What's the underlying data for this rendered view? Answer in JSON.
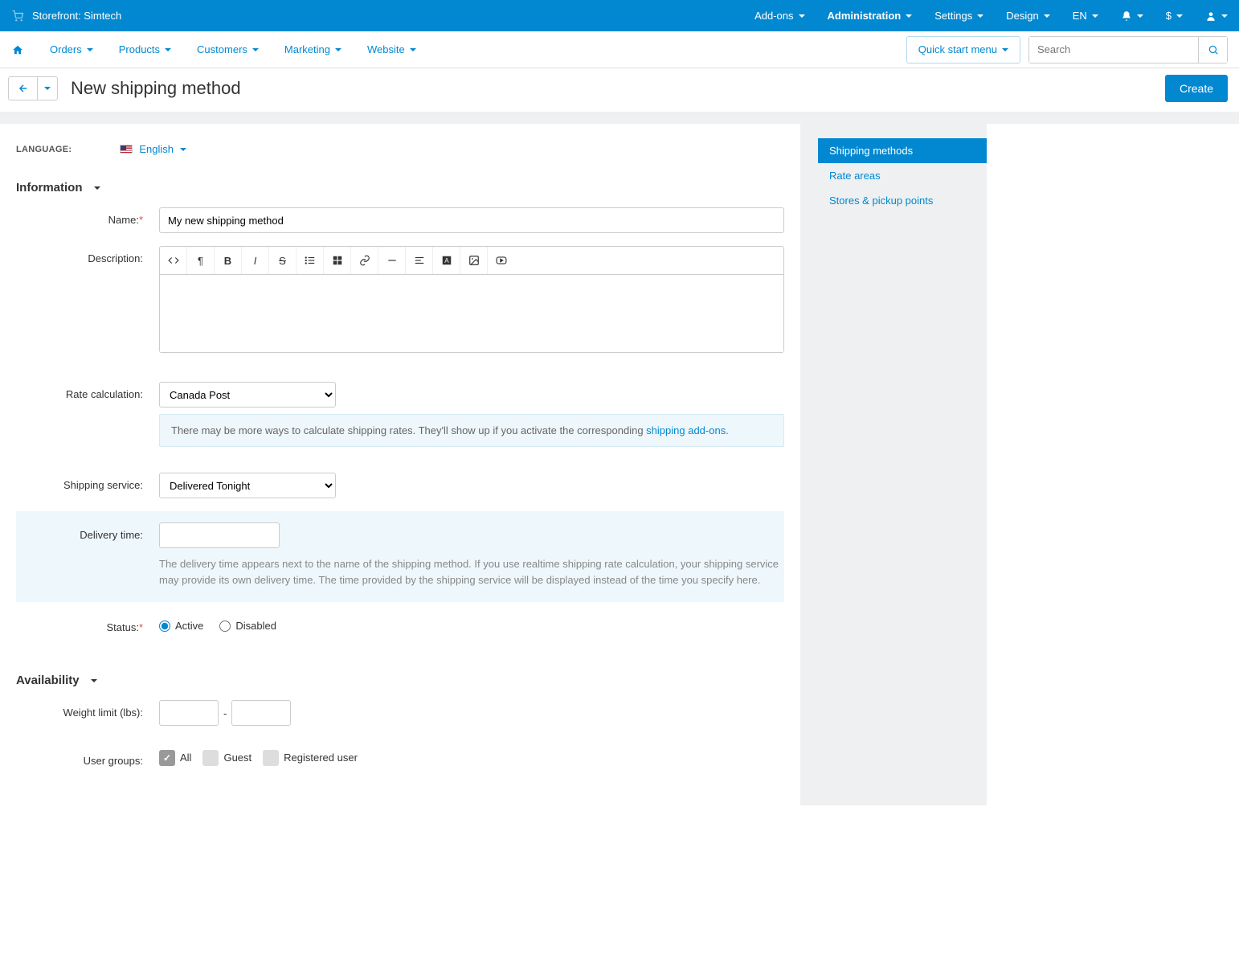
{
  "topbar": {
    "storefront_label": "Storefront: Simtech",
    "addons": "Add-ons",
    "administration": "Administration",
    "settings": "Settings",
    "design": "Design",
    "lang": "EN",
    "currency": "$"
  },
  "nav": {
    "orders": "Orders",
    "products": "Products",
    "customers": "Customers",
    "marketing": "Marketing",
    "website": "Website",
    "quick_start": "Quick start menu",
    "search_placeholder": "Search"
  },
  "page": {
    "title": "New shipping method",
    "create": "Create"
  },
  "right_nav": {
    "shipping_methods": "Shipping methods",
    "rate_areas": "Rate areas",
    "stores_pickup": "Stores & pickup points"
  },
  "language": {
    "label": "LANGUAGE:",
    "value": "English"
  },
  "sections": {
    "information": "Information",
    "availability": "Availability"
  },
  "form": {
    "name_label": "Name:",
    "name_value": "My new shipping method",
    "description_label": "Description:",
    "rate_calc_label": "Rate calculation:",
    "rate_calc_value": "Canada Post",
    "rate_calc_note_pre": "There may be more ways to calculate shipping rates. They'll show up if you activate the corresponding ",
    "rate_calc_note_link": "shipping add-ons",
    "shipping_service_label": "Shipping service:",
    "shipping_service_value": "Delivered Tonight",
    "delivery_time_label": "Delivery time:",
    "delivery_time_help": "The delivery time appears next to the name of the shipping method. If you use realtime shipping rate calculation, your shipping service may provide its own delivery time. The time provided by the shipping service will be displayed instead of the time you specify here.",
    "status_label": "Status:",
    "status_active": "Active",
    "status_disabled": "Disabled",
    "weight_label": "Weight limit (lbs):",
    "weight_sep": "-",
    "usergroups_label": "User groups:",
    "ug_all": "All",
    "ug_guest": "Guest",
    "ug_registered": "Registered user"
  }
}
